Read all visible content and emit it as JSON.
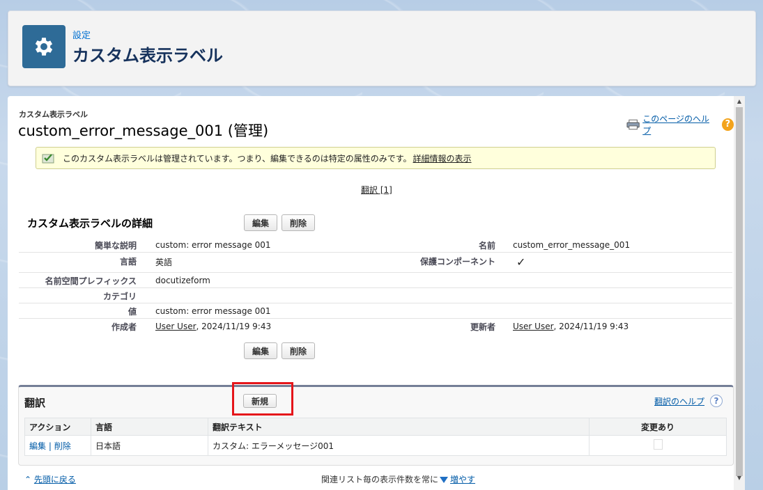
{
  "header": {
    "breadcrumb": "設定",
    "title": "カスタム表示ラベル",
    "icon": "gear-icon"
  },
  "record": {
    "type_label": "カスタム表示ラベル",
    "name": "custom_error_message_001 (管理)",
    "help_link": "このページのヘルプ"
  },
  "notice": {
    "text": "このカスタム表示ラベルは管理されています。つまり、編集できるのは特定の属性のみです。",
    "link": "詳細情報の表示"
  },
  "translation_link": "翻訳 [1]",
  "detail": {
    "section_title": "カスタム表示ラベルの詳細",
    "edit_label": "編集",
    "delete_label": "削除",
    "fields": {
      "short_desc_label": "簡単な説明",
      "short_desc_value": "custom: error message 001",
      "name_label": "名前",
      "name_value": "custom_error_message_001",
      "language_label": "言語",
      "language_value": "英語",
      "protected_label": "保護コンポーネント",
      "protected_value": "✓",
      "namespace_label": "名前空間プレフィックス",
      "namespace_value": "docutizeform",
      "category_label": "カテゴリ",
      "category_value": "",
      "value_label": "値",
      "value_value": "custom: error message 001",
      "created_label": "作成者",
      "created_user": "User User",
      "created_date": ", 2024/11/19 9:43",
      "modified_label": "更新者",
      "modified_user": "User User",
      "modified_date": ", 2024/11/19 9:43"
    }
  },
  "translations": {
    "title": "翻訳",
    "new_label": "新規",
    "help_link": "翻訳のヘルプ",
    "columns": [
      "アクション",
      "言語",
      "翻訳テキスト",
      "変更あり"
    ],
    "rows": [
      {
        "edit": "編集",
        "sep": " | ",
        "delete": "削除",
        "language": "日本語",
        "text": "カスタム: エラーメッセージ001"
      }
    ]
  },
  "footer": {
    "back_to_top": "先頭に戻る",
    "more_prefix": "関連リスト毎の表示件数を常に",
    "more_link": "増やす"
  },
  "colors": {
    "accent": "#015ba7",
    "header_icon_bg": "#2e6b97",
    "highlight": "#e5151a",
    "notice_bg": "#ffffdc"
  }
}
